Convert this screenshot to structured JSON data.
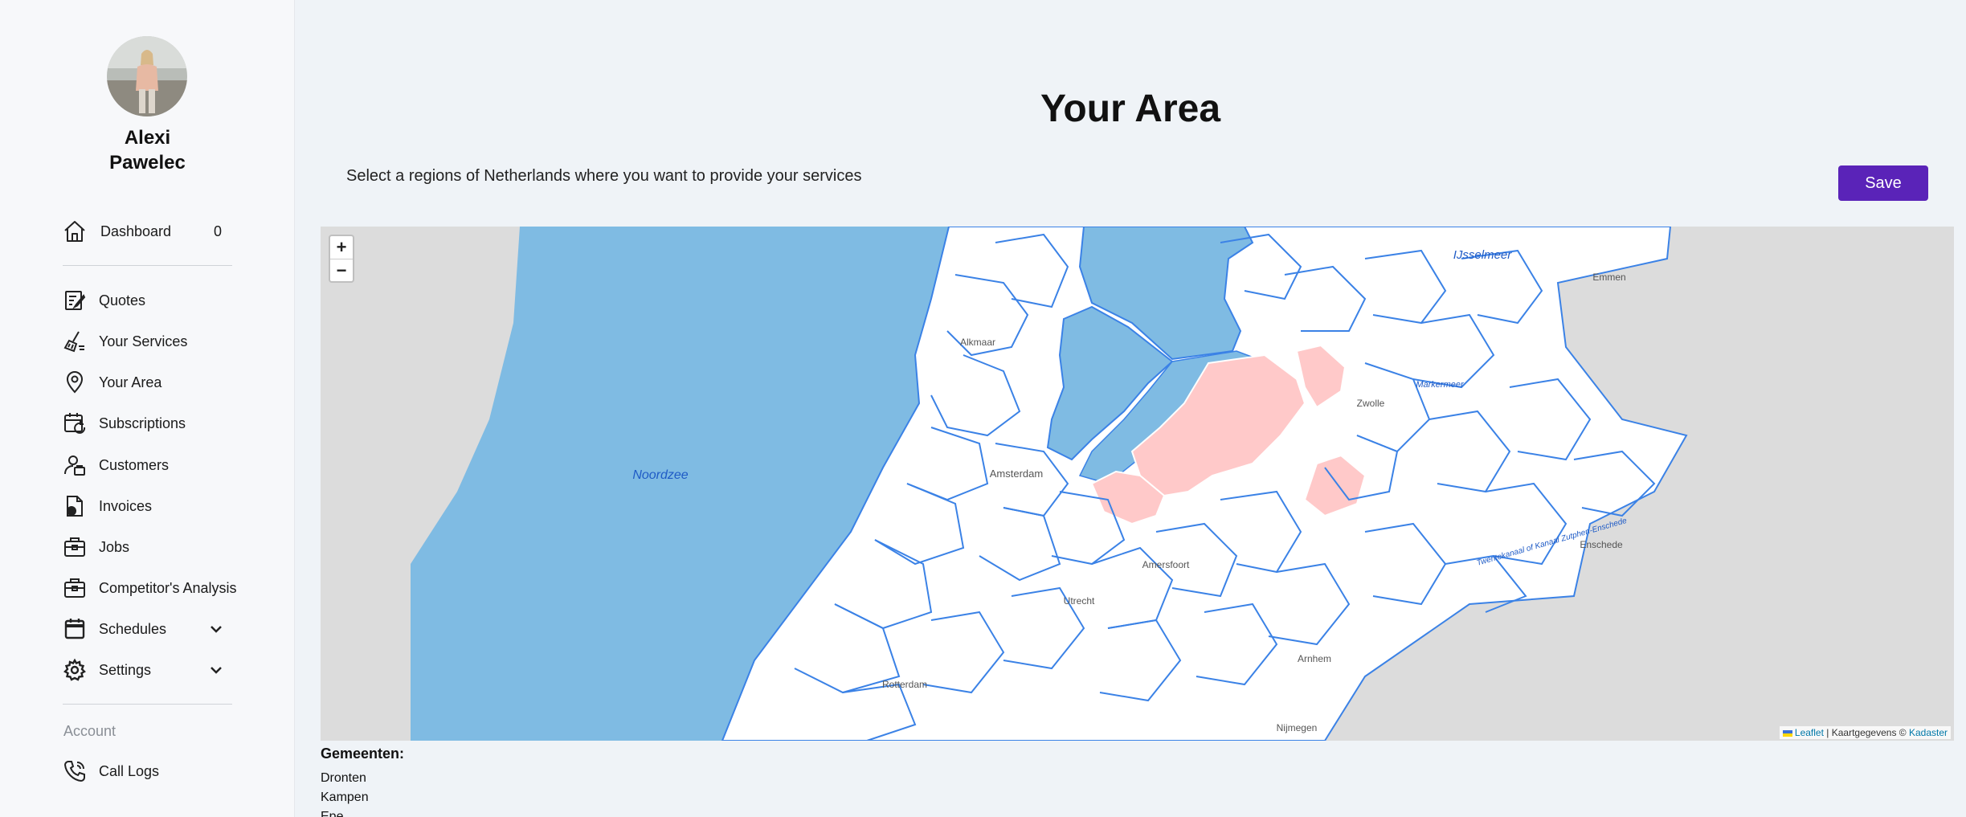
{
  "user": {
    "first_name": "Alexi",
    "last_name": "Pawelec"
  },
  "nav": {
    "dashboard": {
      "label": "Dashboard",
      "count": "0"
    },
    "quotes": "Quotes",
    "services": "Your Services",
    "area": "Your Area",
    "subscriptions": "Subscriptions",
    "customers": "Customers",
    "invoices": "Invoices",
    "jobs": "Jobs",
    "competitor": "Competitor's Analysis",
    "schedules": "Schedules",
    "settings": "Settings",
    "account_section": "Account",
    "call_logs": "Call Logs"
  },
  "main": {
    "title": "Your Area",
    "subtitle": "Select a regions of Netherlands where you want to provide your services",
    "save_label": "Save"
  },
  "map": {
    "zoom_in": "+",
    "zoom_out": "−",
    "labels": {
      "ijsselmeer": "IJsselmeer",
      "markermeer": "Markermeer",
      "noordzee": "Noordzee",
      "alkmaar": "Alkmaar",
      "amsterdam": "Amsterdam",
      "amersfoort": "Amersfoort",
      "utrecht": "Utrecht",
      "rotterdam": "Rotterdam",
      "arnhem": "Arnhem",
      "nijmegen": "Nijmegen",
      "zwolle": "Zwolle",
      "emmen": "Emmen",
      "enschede": "Enschede",
      "twentekanaal": "Twentekanaal of Kanaal Zutphen-Enschede"
    },
    "attribution": {
      "leaflet": "Leaflet",
      "separator": " | Kaartgegevens © ",
      "kadaster": "Kadaster"
    },
    "colors": {
      "water": "#7fbbe3",
      "land": "#ffffff",
      "border": "#3b82e6",
      "selected": "#ffc9c9",
      "outside": "#dcdcdc"
    }
  },
  "gemeenten": {
    "title": "Gemeenten:",
    "items": [
      "Dronten",
      "Kampen",
      "Epe"
    ]
  }
}
